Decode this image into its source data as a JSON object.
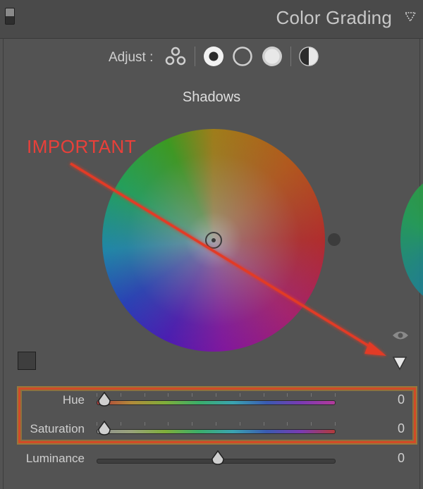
{
  "panel": {
    "title": "Color Grading"
  },
  "adjust": {
    "label": "Adjust :",
    "modes": [
      {
        "icon": "three-way-icon",
        "selected": false
      },
      {
        "icon": "shadows-icon",
        "selected": true
      },
      {
        "icon": "midtones-icon",
        "selected": false
      },
      {
        "icon": "highlights-icon",
        "selected": false
      },
      {
        "icon": "global-icon",
        "selected": false
      }
    ]
  },
  "wheel": {
    "title": "Shadows"
  },
  "annotation": {
    "text": "IMPORTANT",
    "color": "#e8403a"
  },
  "sliders": [
    {
      "label": "Hue",
      "value": "0",
      "position": 0
    },
    {
      "label": "Saturation",
      "value": "0",
      "position": 0
    },
    {
      "label": "Luminance",
      "value": "0",
      "position": 0.5
    }
  ]
}
